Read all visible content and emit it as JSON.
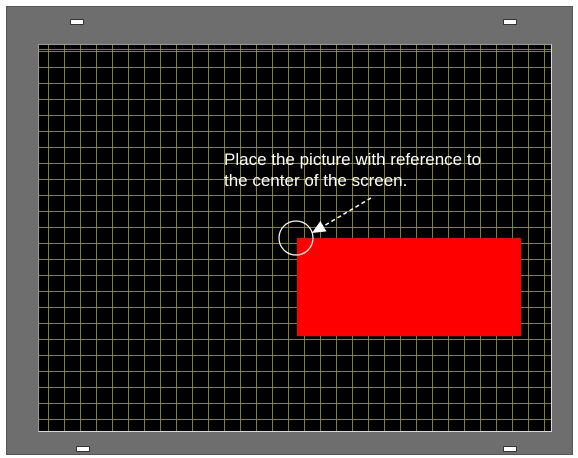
{
  "annotation": {
    "line1": "Place the picture with reference to",
    "line2": "the center of the screen."
  },
  "colors": {
    "bezel": "#6e6e6e",
    "screen_background": "#000000",
    "grid_lines": "#969637",
    "picture_fill": "#ff0000",
    "annotation_text": "#ffffff"
  },
  "icons": {
    "reference_marker": "circle-marker-icon",
    "pointer": "dashed-arrow-icon"
  }
}
